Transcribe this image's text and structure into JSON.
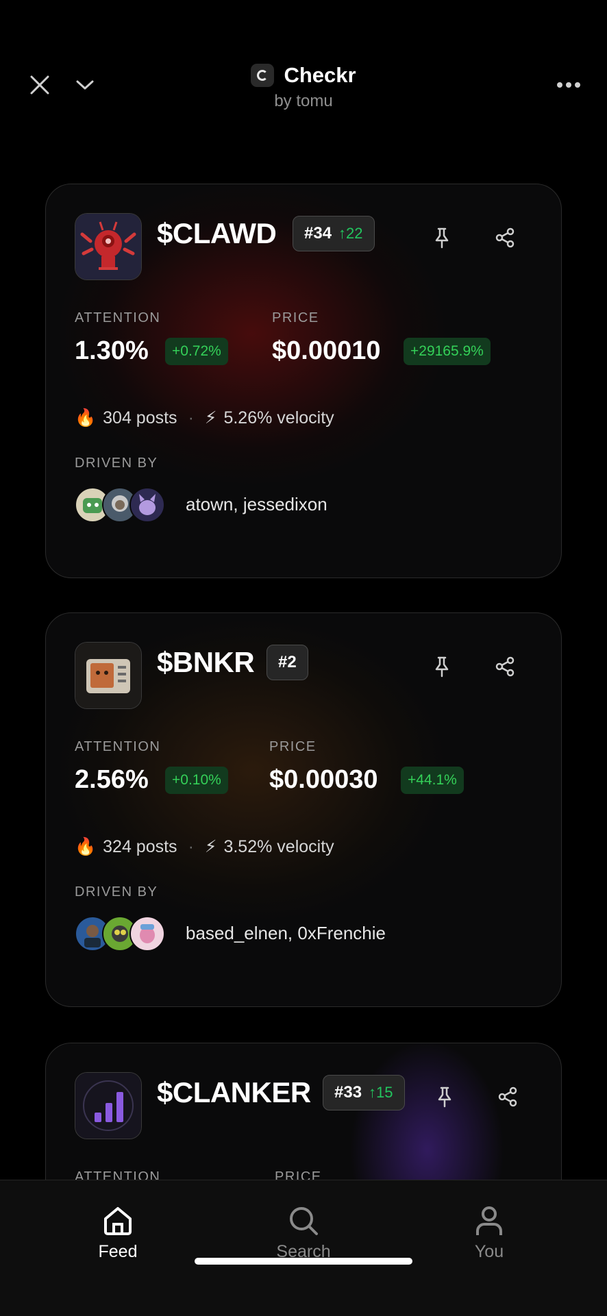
{
  "app": {
    "title": "Checkr",
    "subtitle": "by tomu"
  },
  "cards": [
    {
      "ticker": "$CLAWD",
      "rank": "#34",
      "rank_change": "↑22",
      "attention_label": "ATTENTION",
      "attention_value": "1.30%",
      "attention_change": "+0.72%",
      "price_label": "PRICE",
      "price_value": "$0.00010",
      "price_change": "+29165.9%",
      "posts": "304 posts",
      "velocity": "5.26% velocity",
      "driven_label": "DRIVEN BY",
      "drivers": "atown, jessedixon"
    },
    {
      "ticker": "$BNKR",
      "rank": "#2",
      "attention_label": "ATTENTION",
      "attention_value": "2.56%",
      "attention_change": "+0.10%",
      "price_label": "PRICE",
      "price_value": "$0.00030",
      "price_change": "+44.1%",
      "posts": "324 posts",
      "velocity": "3.52% velocity",
      "driven_label": "DRIVEN BY",
      "drivers": "based_elnen, 0xFrenchie"
    },
    {
      "ticker": "$CLANKER",
      "rank": "#33",
      "rank_change": "↑15",
      "attention_label": "ATTENTION",
      "price_label": "PRICE"
    }
  ],
  "nav": {
    "feed": "Feed",
    "search": "Search",
    "you": "You"
  },
  "colors": {
    "positive": "#34d058",
    "background": "#000000",
    "card": "#0a0a0b"
  },
  "glyphs": {
    "fire": "🔥",
    "bolt": "⚡",
    "sep": "·"
  }
}
